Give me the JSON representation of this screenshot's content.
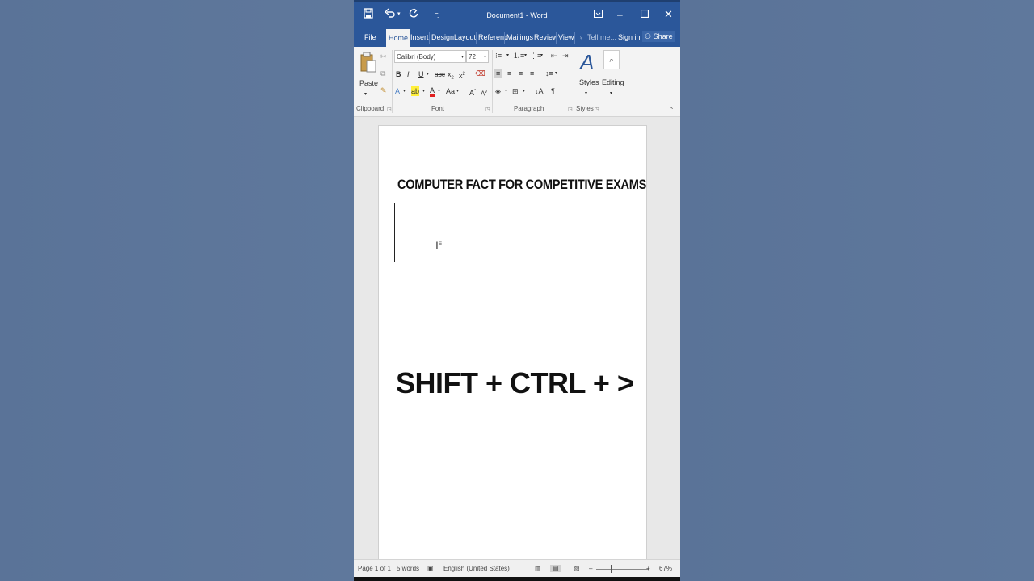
{
  "window": {
    "title": "Document1 - Word",
    "accent": "#2b579a"
  },
  "titlebar": {
    "save_icon": "save-icon",
    "undo_icon": "undo-icon",
    "redo_icon": "redo-icon",
    "customize_icon": "customize-icon",
    "ribbon_display_icon": "ribbon-display-icon",
    "minimize_icon": "minimize-icon",
    "maximize_icon": "maximize-icon",
    "close_icon": "close-icon"
  },
  "tabs": [
    "File",
    "Home",
    "Insert",
    "Design",
    "Layout",
    "Referenc",
    "Mailings",
    "Review",
    "View"
  ],
  "active_tab": "Home",
  "tell_me": "Tell me...",
  "sign_in": "Sign in",
  "share": "Share",
  "ribbon": {
    "clipboard": {
      "label": "Clipboard",
      "paste": "Paste"
    },
    "font": {
      "label": "Font",
      "font_name": "Calibri (Body)",
      "font_size": "72"
    },
    "paragraph": {
      "label": "Paragraph"
    },
    "styles": {
      "label": "Styles",
      "styles_button": "Styles"
    },
    "editing": {
      "label": "Editing"
    }
  },
  "document": {
    "heading": "COMPUTER FACT FOR COMPETITIVE EXAMS",
    "shortcut_text": "SHIFT + CTRL + >"
  },
  "status": {
    "page": "Page 1 of 1",
    "words": "5 words",
    "language": "English (United States)",
    "zoom": "67%"
  }
}
